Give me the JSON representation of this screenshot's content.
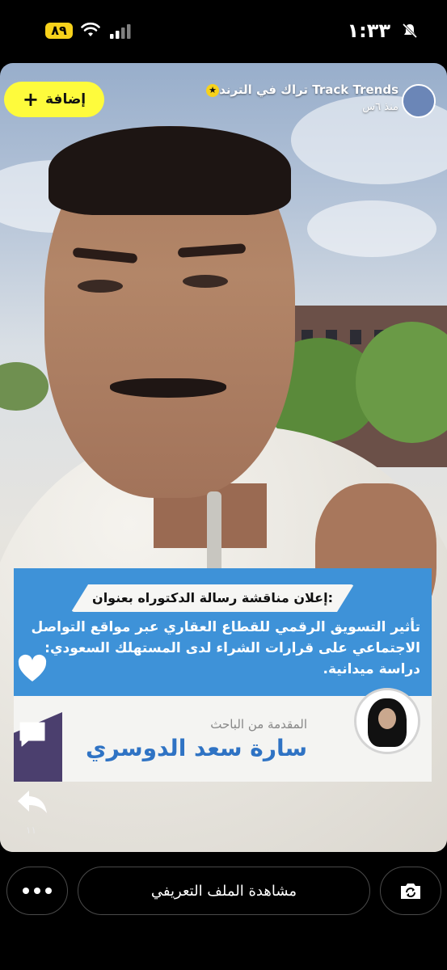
{
  "status_bar": {
    "time": "١:٣٣",
    "battery": "٨٩",
    "icons": [
      "mute-icon",
      "wifi-icon",
      "signal-icon",
      "battery-icon"
    ]
  },
  "story": {
    "add_button": {
      "label": "إضافة",
      "icon": "plus-icon"
    },
    "channel": {
      "name": "تراك في الترند  Track Trends",
      "posted": "منذ ٦س",
      "icons": [
        "star-badge-icon",
        "channel-logo-icon"
      ]
    },
    "card": {
      "heading": "إعلان مناقشة رسالة الدكتوراه بعنوان:",
      "body": "تأثير التسويق الرقمي للقطاع العقاري عبر مواقع التواصل الاجتماعي على قرارات الشراء لدى المستهلك السعودي: دراسة ميدانية.",
      "presenter_label": "المقدمة من الباحث",
      "presenter_name": "سارة سعد الدوسري"
    },
    "side_actions": {
      "icons": [
        "heart-icon",
        "comment-icon",
        "share-icon"
      ],
      "share_count": "١١"
    }
  },
  "bottom_bar": {
    "profile_button": "مشاهدة الملف التعريفي",
    "icons": [
      "more-icon",
      "camera-flip-icon"
    ]
  },
  "colors": {
    "accent_yellow": "#fefb3c",
    "card_blue": "#3e92d8",
    "name_blue": "#2f73c4",
    "background": "#000000"
  }
}
